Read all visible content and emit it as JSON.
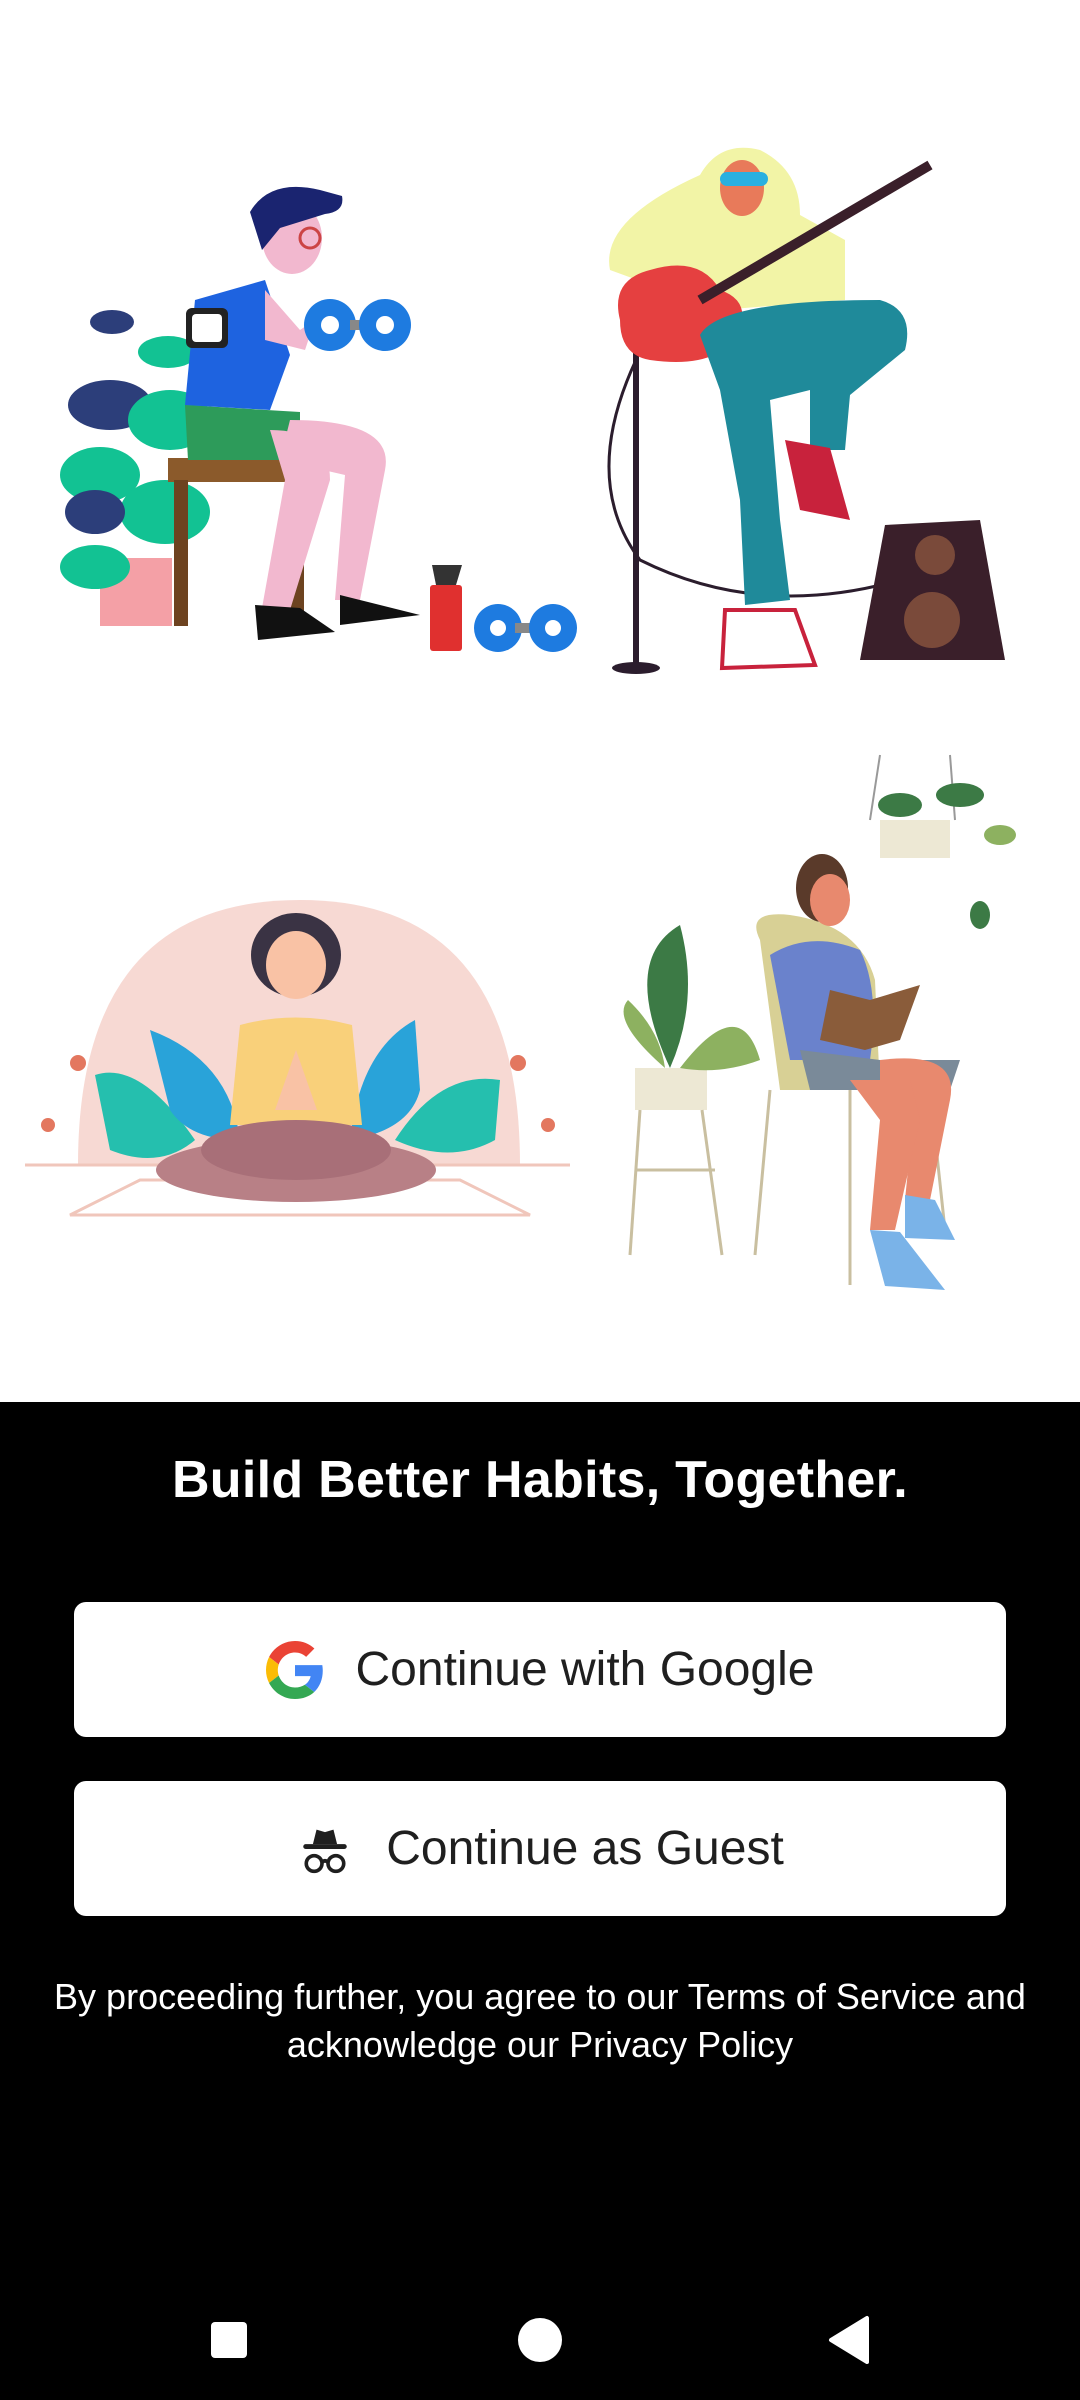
{
  "onboarding": {
    "illustrations": [
      "fitness-illustration",
      "guitarist-illustration",
      "meditation-illustration",
      "reading-illustration"
    ],
    "headline": "Build Better Habits, Together.",
    "google_button": {
      "label": "Continue with Google",
      "icon": "google-logo-icon"
    },
    "guest_button": {
      "label": "Continue as Guest",
      "icon": "incognito-icon"
    },
    "legal": {
      "prefix": "By proceeding further, you agree to our ",
      "terms_link": "Terms of Service",
      "middle": " and acknowledge our ",
      "privacy_link": "Privacy Policy"
    }
  },
  "navigation_bar": {
    "buttons": [
      "recents-icon",
      "home-icon",
      "back-icon"
    ]
  },
  "colors": {
    "panel_background": "#000000",
    "button_background": "#ffffff",
    "text_light": "#ffffff",
    "text_dark": "#1f1f1f"
  }
}
